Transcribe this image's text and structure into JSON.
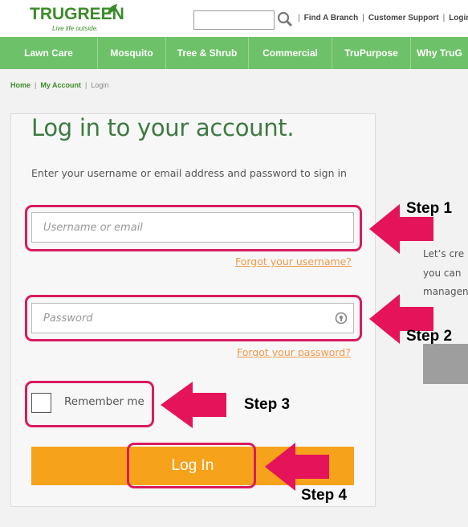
{
  "header": {
    "logo_name": "TRUGREEN",
    "logo_tagline": "Live life outside.",
    "search": {
      "value": "",
      "placeholder": ""
    },
    "links": [
      "Find A Branch",
      "Customer Support",
      "Login"
    ]
  },
  "nav": {
    "items": [
      "Lawn Care",
      "Mosquito",
      "Tree & Shrub",
      "Commercial",
      "TruPurpose",
      "Why TruG"
    ]
  },
  "breadcrumb": {
    "home": "Home",
    "account": "My Account",
    "current": "Login"
  },
  "login": {
    "title": "Log in to your account.",
    "subtitle": "Enter your username or email address and password to sign in",
    "username_placeholder": "Username or email",
    "forgot_username": "Forgot your username?",
    "password_placeholder": "Password",
    "forgot_password": "Forgot your password?",
    "remember_label": "Remember me",
    "button_label": "Log In"
  },
  "annotations": {
    "steps": [
      "Step 1",
      "Step 2",
      "Step 3",
      "Step 4"
    ]
  },
  "side_panel": {
    "lines": [
      "Let’s cre",
      "you  can",
      "managen"
    ]
  },
  "colors": {
    "brand_green": "#3b8c2a",
    "nav_green": "#6dc168",
    "button_orange": "#f7a21b",
    "link_orange": "#f19a4a",
    "highlight_pink": "#d81b60"
  }
}
